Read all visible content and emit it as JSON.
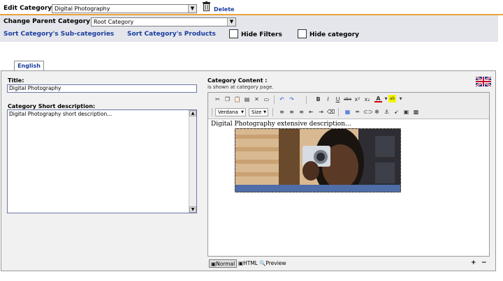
{
  "edit_category": {
    "label": "Edit Category:",
    "value": "Digital Photography",
    "delete_label": "Delete"
  },
  "parent_category": {
    "label": "Change Parent Category :",
    "value": "Root Category"
  },
  "links": {
    "sort_subcategories": "Sort Category's Sub-categories",
    "sort_products": "Sort Category's Products"
  },
  "checkboxes": {
    "hide_filters": "Hide Filters",
    "hide_category": "Hide category"
  },
  "tab": {
    "label": "English"
  },
  "title_field": {
    "label": "Title:",
    "value": "Digital Photography"
  },
  "short_description": {
    "label": "Category Short description:",
    "value": "Digital Photography short description..."
  },
  "category_content": {
    "label": "Category Content :",
    "sublabel": "is shown at category page.",
    "text": "Digital Photography extensive description..."
  },
  "editor_toolbar": {
    "font_name": "Verdana",
    "font_size": "Size"
  },
  "editor_modes": {
    "normal": "Normal",
    "html": "HTML",
    "preview": "Preview"
  }
}
